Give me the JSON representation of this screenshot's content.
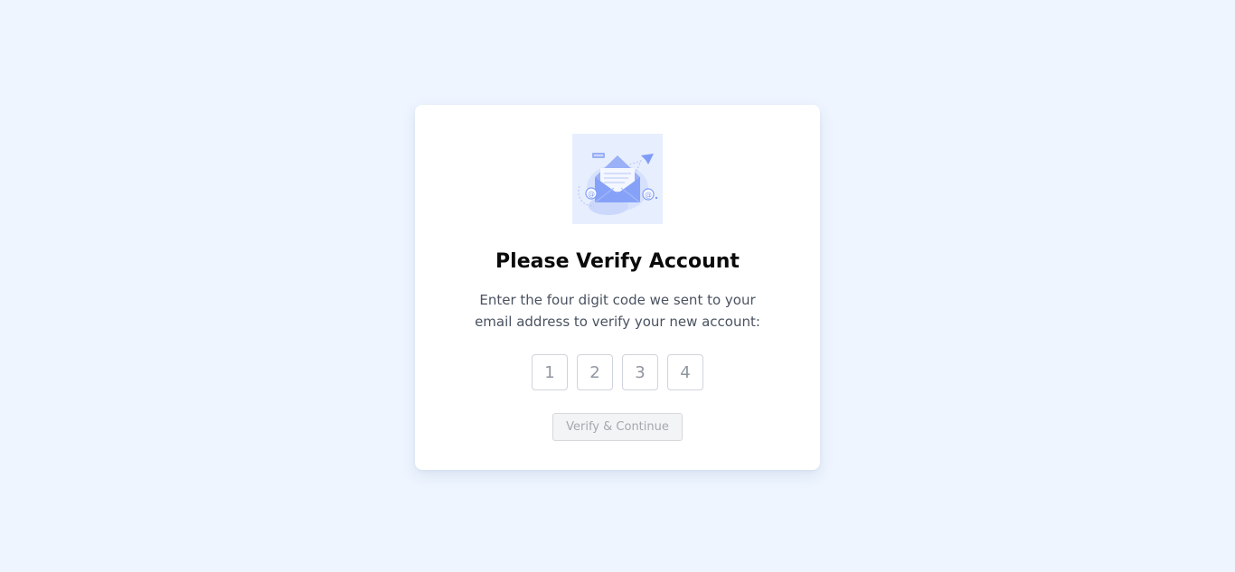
{
  "card": {
    "title": "Please Verify Account",
    "subtitle": "Enter the four digit code we sent to your email address to verify your new account:",
    "illustration_icon": "email-envelope-illustration"
  },
  "code_inputs": [
    {
      "placeholder": "1",
      "value": ""
    },
    {
      "placeholder": "2",
      "value": ""
    },
    {
      "placeholder": "3",
      "value": ""
    },
    {
      "placeholder": "4",
      "value": ""
    }
  ],
  "verify_button": {
    "label": "Verify & Continue",
    "state": "disabled"
  },
  "colors": {
    "page_background": "#eef5ff",
    "card_background": "#ffffff",
    "accent": "#7f9cf7",
    "button_disabled_bg": "#f3f4f6",
    "button_disabled_text": "#a4a8ae"
  }
}
